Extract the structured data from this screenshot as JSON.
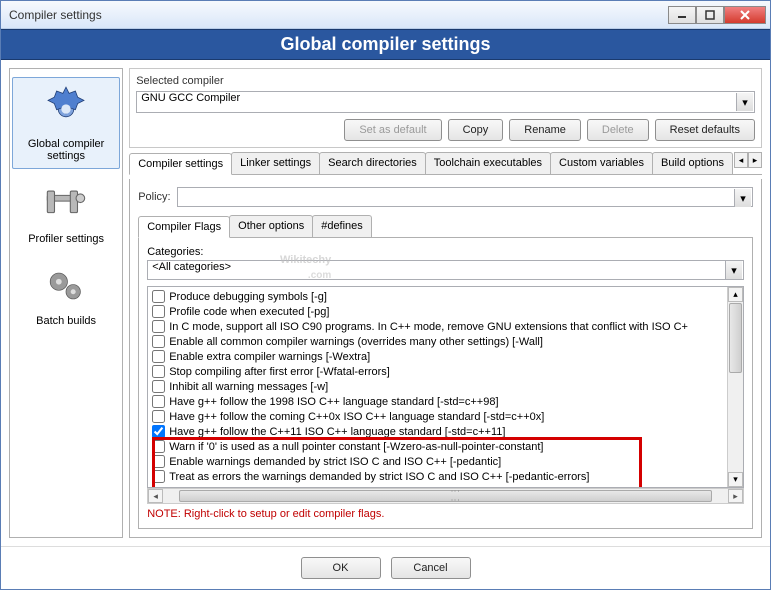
{
  "window": {
    "title": "Compiler settings"
  },
  "banner": "Global compiler settings",
  "sidebar": {
    "items": [
      {
        "label": "Global compiler settings"
      },
      {
        "label": "Profiler settings"
      },
      {
        "label": "Batch builds"
      }
    ]
  },
  "selected_compiler": {
    "label": "Selected compiler",
    "value": "GNU GCC Compiler",
    "buttons": {
      "set_default": "Set as default",
      "copy": "Copy",
      "rename": "Rename",
      "delete": "Delete",
      "reset": "Reset defaults"
    }
  },
  "tabs": [
    "Compiler settings",
    "Linker settings",
    "Search directories",
    "Toolchain executables",
    "Custom variables",
    "Build options"
  ],
  "policy": {
    "label": "Policy:"
  },
  "inner_tabs": [
    "Compiler Flags",
    "Other options",
    "#defines"
  ],
  "categories": {
    "label": "Categories:",
    "value": "<All categories>"
  },
  "flags": [
    {
      "checked": false,
      "text": "Produce debugging symbols  [-g]"
    },
    {
      "checked": false,
      "text": "Profile code when executed  [-pg]"
    },
    {
      "checked": false,
      "text": "In C mode, support all ISO C90 programs. In C++ mode, remove GNU extensions that conflict with ISO C+"
    },
    {
      "checked": false,
      "text": "Enable all common compiler warnings (overrides many other settings)  [-Wall]"
    },
    {
      "checked": false,
      "text": "Enable extra compiler warnings  [-Wextra]"
    },
    {
      "checked": false,
      "text": "Stop compiling after first error  [-Wfatal-errors]"
    },
    {
      "checked": false,
      "text": "Inhibit all warning messages  [-w]"
    },
    {
      "checked": false,
      "text": "Have g++ follow the 1998 ISO C++ language standard  [-std=c++98]"
    },
    {
      "checked": false,
      "text": "Have g++ follow the coming C++0x ISO C++ language standard  [-std=c++0x]"
    },
    {
      "checked": true,
      "text": "Have g++ follow the C++11 ISO C++ language standard  [-std=c++11]"
    },
    {
      "checked": false,
      "text": "Warn if '0' is used as a null pointer constant  [-Wzero-as-null-pointer-constant]"
    },
    {
      "checked": false,
      "text": "Enable warnings demanded by strict ISO C and ISO C++  [-pedantic]"
    },
    {
      "checked": false,
      "text": "Treat as errors the warnings demanded by strict ISO C and ISO C++  [-pedantic-errors]"
    }
  ],
  "note": "NOTE: Right-click to setup or edit compiler flags.",
  "footer": {
    "ok": "OK",
    "cancel": "Cancel"
  },
  "watermark": {
    "main": "Wikitechy",
    "sub": ".com"
  }
}
